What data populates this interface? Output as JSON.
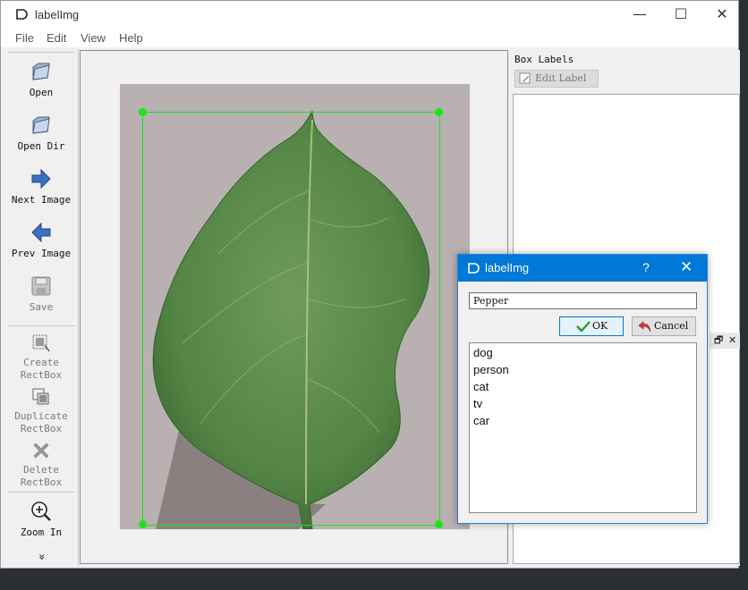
{
  "window": {
    "app_title": "labelImg",
    "controls": {
      "minimize": "—",
      "maximize": "☐",
      "close": "✕"
    }
  },
  "menu": [
    "File",
    "Edit",
    "View",
    "Help"
  ],
  "toolbar": {
    "open": "Open",
    "open_dir": "Open Dir",
    "next_image": "Next Image",
    "prev_image": "Prev Image",
    "save": "Save",
    "create_line1": "Create",
    "create_line2": "RectBox",
    "duplicate_line1": "Duplicate",
    "duplicate_line2": "RectBox",
    "delete_line1": "Delete",
    "delete_line2": "RectBox",
    "zoom_in": "Zoom In",
    "more": "»"
  },
  "right_panel": {
    "title": "Box Labels",
    "edit_label": "Edit Label",
    "dock_float": "🗗",
    "dock_close": "✕"
  },
  "dialog": {
    "title": "labelImg",
    "help": "?",
    "close": "✕",
    "input_value": "Pepper",
    "ok_label": "OK",
    "cancel_label": "Cancel",
    "label_options": [
      "dog",
      "person",
      "cat",
      "tv",
      "car"
    ]
  },
  "colors": {
    "accent": "#0078d7",
    "bbox": "#19e619",
    "leaf": "#5a8a4c"
  }
}
